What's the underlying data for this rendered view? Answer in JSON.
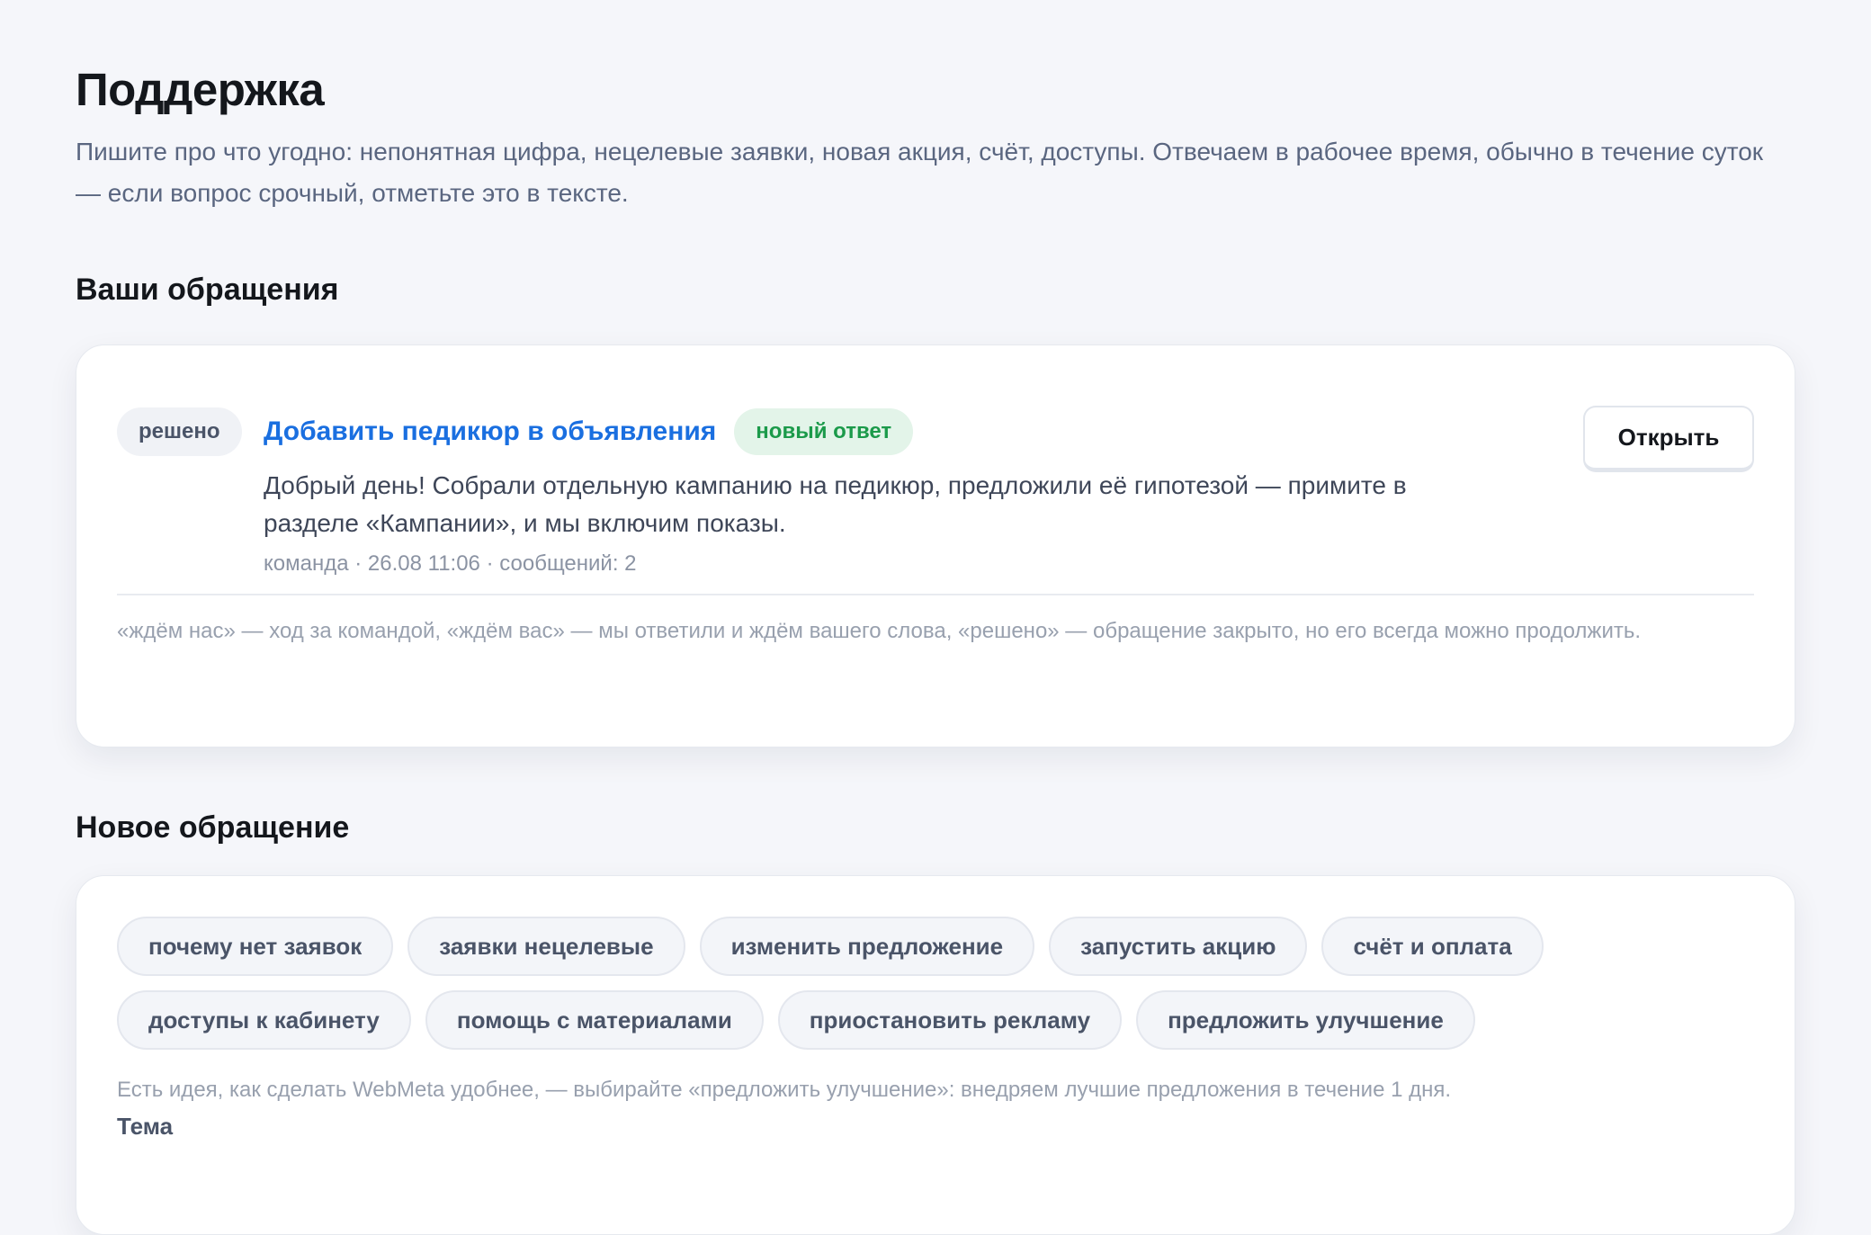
{
  "header": {
    "title": "Поддержка",
    "lead": "Пишите про что угодно: непонятная цифра, нецелевые заявки, новая акция, счёт, доступы. Отвечаем в рабочее время, обычно в течение суток — если вопрос срочный, отметьте это в тексте."
  },
  "tickets": {
    "heading": "Ваши обращения",
    "items": [
      {
        "status": "решено",
        "title": "Добавить педикюр в объявления",
        "badge": "новый ответ",
        "text": "Добрый день! Собрали отдельную кампанию на педикюр, предложили её гипотезой — примите в разделе «Кампании», и мы включим показы.",
        "meta": "команда · 26.08 11:06 · сообщений: 2",
        "open_label": "Открыть"
      }
    ],
    "legend": "«ждём нас» — ход за командой, «ждём вас» — мы ответили и ждём вашего слова, «решено» — обращение закрыто, но его всегда можно продолжить."
  },
  "new_ticket": {
    "heading": "Новое обращение",
    "topics": [
      "почему нет заявок",
      "заявки нецелевые",
      "изменить предложение",
      "запустить акцию",
      "счёт и оплата",
      "доступы к кабинету",
      "помощь с материалами",
      "приостановить рекламу",
      "предложить улучшение"
    ],
    "hint": "Есть идея, как сделать WebMeta удобнее, — выбирайте «предложить улучшение»: внедряем лучшие предложения в течение 1 дня.",
    "subject_label": "Тема"
  },
  "colors": {
    "accent_link": "#1a6fe0",
    "badge_green": "#1b9a4a",
    "background": "#f5f6fa"
  }
}
